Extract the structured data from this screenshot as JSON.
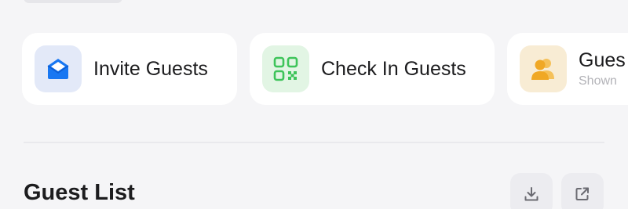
{
  "actions": [
    {
      "title": "Invite Guests",
      "icon": "envelope-icon",
      "color": "#1877f2"
    },
    {
      "title": "Check In Guests",
      "icon": "qr-code-icon",
      "color": "#3ec45a"
    },
    {
      "title": "Gues",
      "subtitle": "Shown",
      "icon": "people-icon",
      "color": "#f0a825"
    }
  ],
  "guest_list": {
    "title": "Guest List",
    "buttons": [
      {
        "icon": "download-icon"
      },
      {
        "icon": "external-link-icon"
      }
    ]
  }
}
